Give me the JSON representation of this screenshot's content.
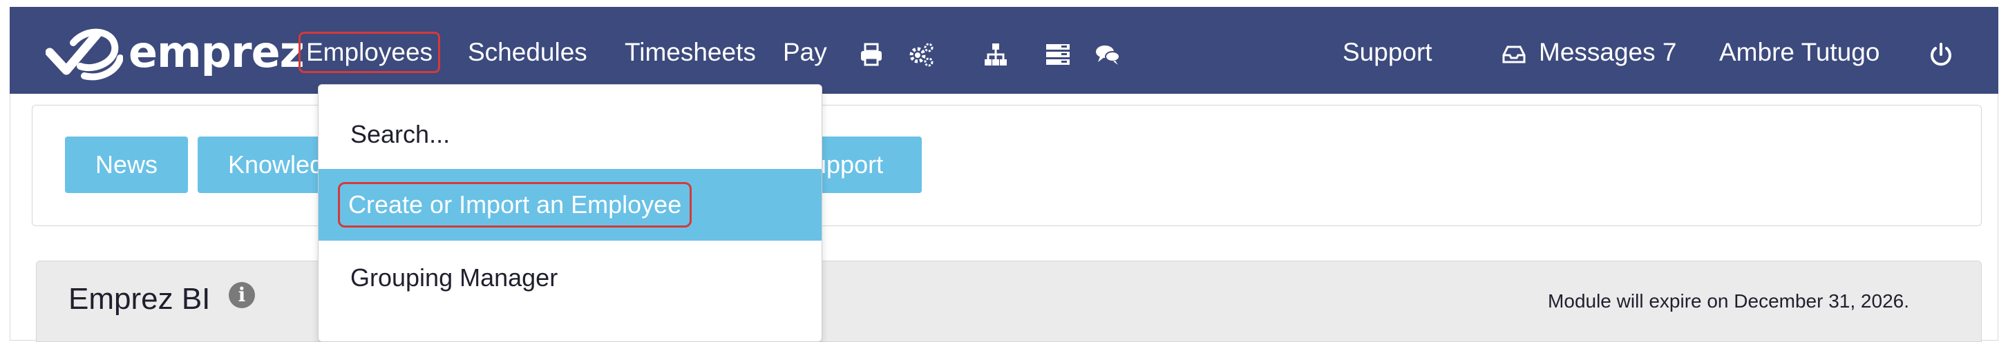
{
  "brand": {
    "name": "emprez"
  },
  "nav": {
    "employees": "Employees",
    "schedules": "Schedules",
    "timesheets": "Timesheets",
    "pay": "Pay",
    "support": "Support",
    "messages": "Messages 7",
    "user": "Ambre Tutugo"
  },
  "icons": [
    "print-icon",
    "gears-icon",
    "org-chart-icon",
    "server-icon",
    "chat-icon",
    "inbox-icon",
    "power-icon",
    "info-icon"
  ],
  "dropdown": {
    "items": [
      "Search...",
      "Create or Import an Employee",
      "Grouping Manager"
    ]
  },
  "panel": {
    "buttons": [
      "News",
      "Knowled",
      "upport"
    ]
  },
  "bi": {
    "title": "Emprez BI",
    "info_symbol": "i",
    "expire_text": "Module will expire on December 31, 2026."
  },
  "colors": {
    "navbar": "#3c4a7d",
    "accent": "#69c1e6",
    "highlight": "#d43a3a"
  }
}
